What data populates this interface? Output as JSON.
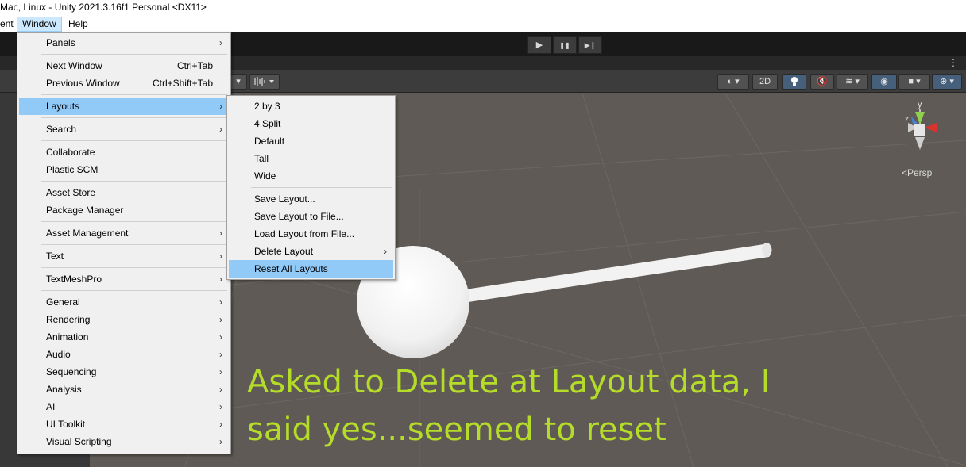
{
  "titlebar": {
    "title": "Mac, Linux - Unity 2021.3.16f1 Personal <DX11>"
  },
  "menubar": {
    "items": [
      "ent",
      "Window",
      "Help"
    ]
  },
  "playbar": {
    "play": "▶",
    "pause": "❚❚",
    "step": "▶❙"
  },
  "scene_toolbar": {
    "mode_2d": "2D"
  },
  "viewport": {
    "persp_label": "<Persp",
    "gizmo_labels": {
      "y": "y",
      "z": "z"
    },
    "overlay_text_line1": "Asked to Delete at Layout data, I",
    "overlay_text_line2": "said yes...seemed to reset",
    "overlay_color": "#b4dc28"
  },
  "window_menu": {
    "items": [
      {
        "label": "Panels",
        "has_submenu": true
      },
      {
        "label": "Next Window",
        "shortcut": "Ctrl+Tab"
      },
      {
        "label": "Previous Window",
        "shortcut": "Ctrl+Shift+Tab"
      },
      {
        "label": "Layouts",
        "has_submenu": true,
        "highlighted": true
      },
      {
        "label": "Search",
        "has_submenu": true
      },
      {
        "label": "Collaborate"
      },
      {
        "label": "Plastic SCM"
      },
      {
        "label": "Asset Store"
      },
      {
        "label": "Package Manager"
      },
      {
        "label": "Asset Management",
        "has_submenu": true
      },
      {
        "label": "Text",
        "has_submenu": true
      },
      {
        "label": "TextMeshPro",
        "has_submenu": true
      },
      {
        "label": "General",
        "has_submenu": true
      },
      {
        "label": "Rendering",
        "has_submenu": true
      },
      {
        "label": "Animation",
        "has_submenu": true
      },
      {
        "label": "Audio",
        "has_submenu": true
      },
      {
        "label": "Sequencing",
        "has_submenu": true
      },
      {
        "label": "Analysis",
        "has_submenu": true
      },
      {
        "label": "AI",
        "has_submenu": true
      },
      {
        "label": "UI Toolkit",
        "has_submenu": true
      },
      {
        "label": "Visual Scripting",
        "has_submenu": true
      }
    ]
  },
  "layouts_submenu": {
    "items": [
      {
        "label": "2 by 3"
      },
      {
        "label": "4 Split"
      },
      {
        "label": "Default"
      },
      {
        "label": "Tall"
      },
      {
        "label": "Wide"
      },
      {
        "label": "Save Layout..."
      },
      {
        "label": "Save Layout to File..."
      },
      {
        "label": "Load Layout from File..."
      },
      {
        "label": "Delete Layout",
        "has_submenu": true
      },
      {
        "label": "Reset All Layouts",
        "highlighted": true
      }
    ]
  },
  "colors": {
    "menu_bg": "#f0f0f0",
    "menu_highlight": "#91c9f7",
    "viewport_bg": "#5f5a55",
    "editor_dark": "#191919"
  }
}
